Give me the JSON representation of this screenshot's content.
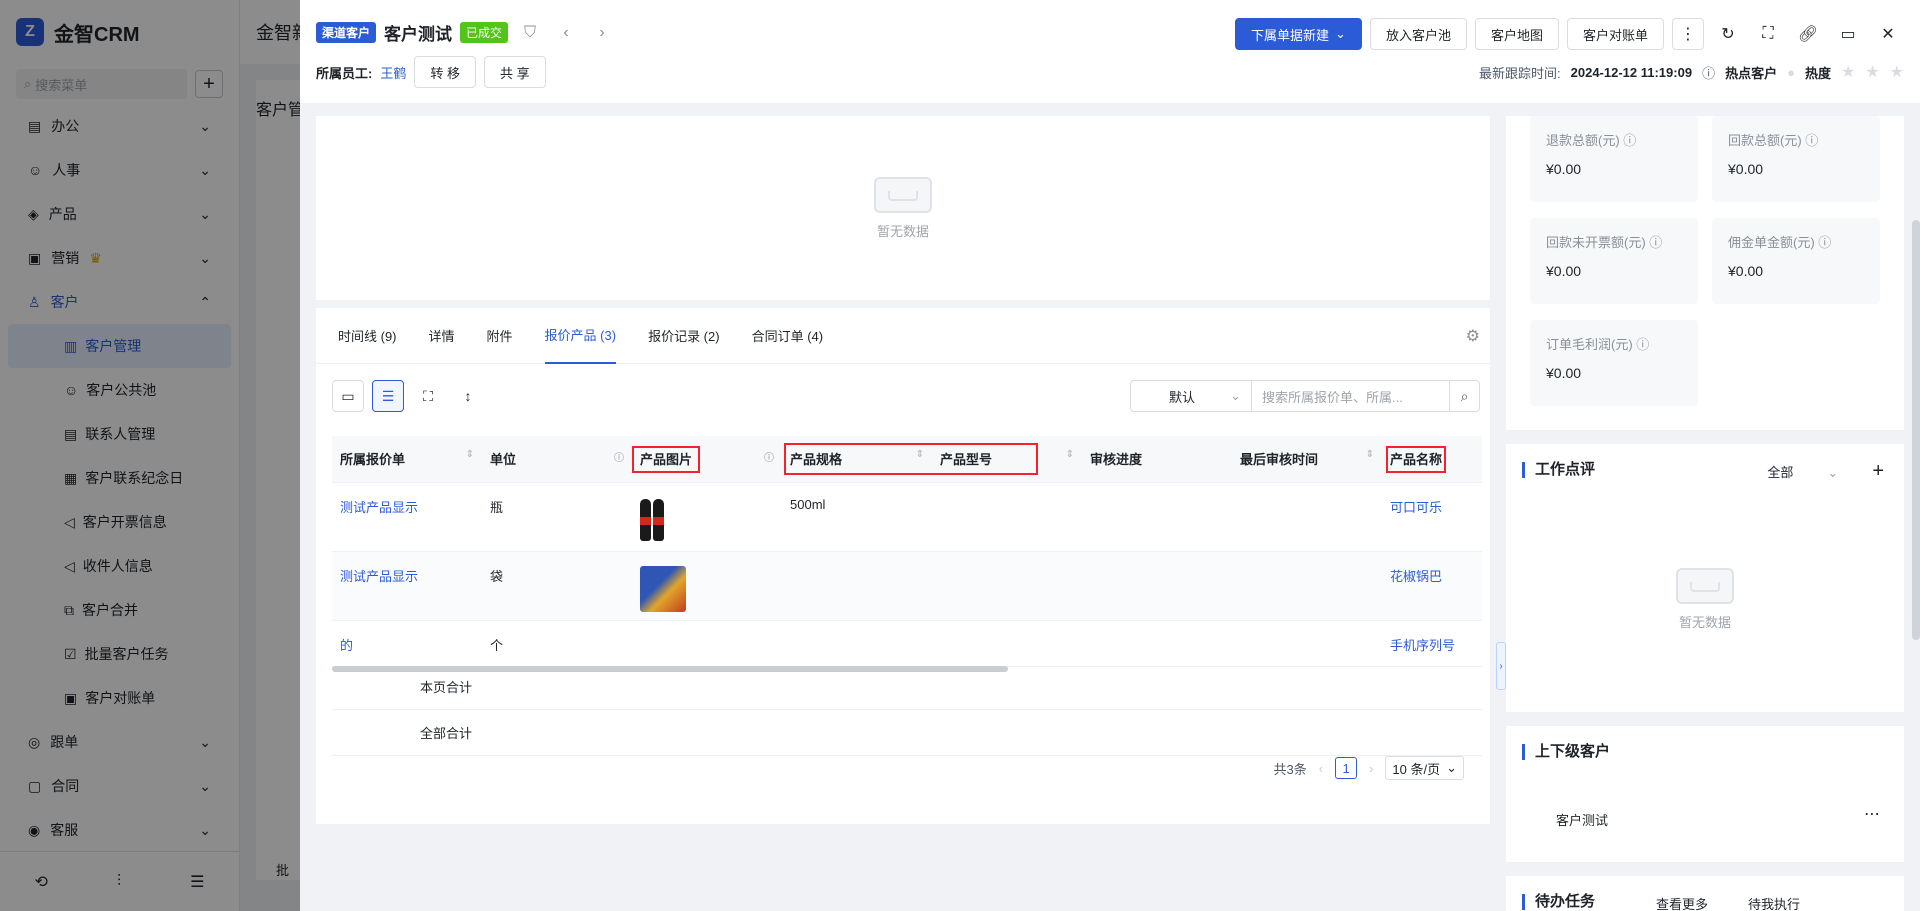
{
  "app": {
    "name": "金智CRM",
    "header_title": "金智新",
    "search_placeholder": "搜索菜单",
    "menu": [
      {
        "label": "办公",
        "icon": "calendar-icon"
      },
      {
        "label": "人事",
        "icon": "people-icon"
      },
      {
        "label": "产品",
        "icon": "box-icon"
      },
      {
        "label": "营销",
        "icon": "gift-icon"
      },
      {
        "label": "客户",
        "icon": "user-icon"
      }
    ],
    "customer_submenu": [
      "客户管理",
      "客户公共池",
      "联系人管理",
      "客户联系纪念日",
      "客户开票信息",
      "收件人信息",
      "客户合并",
      "批量客户任务",
      "客户对账单"
    ],
    "menu_bottom": [
      {
        "label": "跟单"
      },
      {
        "label": "合同"
      },
      {
        "label": "客服"
      }
    ],
    "bg_page_title": "客户管",
    "bg_bottom_button": "批"
  },
  "drawer": {
    "tag_channel": "渠道客户",
    "customer_name": "客户测试",
    "tag_status": "已成交",
    "owner_label": "所属员工:",
    "owner_name": "王鹤",
    "transfer_label": "转 移",
    "share_label": "共 享",
    "new_doc_label": "下属单据新建",
    "put_pool_label": "放入客户池",
    "map_label": "客户地图",
    "statement_label": "客户对账单",
    "last_follow_label": "最新跟踪时间:",
    "last_follow_time": "2024-12-12 11:19:09",
    "hot_label": "热点客户",
    "heat_label": "热度",
    "heat_stars": 0
  },
  "top_panel": {
    "empty_text": "暂无数据"
  },
  "tabs": [
    {
      "label": "时间线 (9)"
    },
    {
      "label": "详情"
    },
    {
      "label": "附件"
    },
    {
      "label": "报价产品 (3)"
    },
    {
      "label": "报价记录 (2)"
    },
    {
      "label": "合同订单 (4)"
    }
  ],
  "toolbar": {
    "select_value": "默认",
    "search_placeholder": "搜索所属报价单、所属..."
  },
  "table": {
    "columns": [
      "所属报价单",
      "单位",
      "产品图片",
      "产品规格",
      "产品型号",
      "审核进度",
      "最后审核时间",
      "产品名称"
    ],
    "rows": [
      {
        "quote": "测试产品显示",
        "unit": "瓶",
        "image": "cola-bottles-image",
        "spec": "500ml",
        "model": "",
        "progress": "",
        "time": "",
        "name": "可口可乐"
      },
      {
        "quote": "测试产品显示",
        "unit": "袋",
        "image": "snack-bag-image",
        "spec": "",
        "model": "",
        "progress": "",
        "time": "",
        "name": "花椒锅巴"
      },
      {
        "quote": "的",
        "unit": "个",
        "image": "",
        "spec": "",
        "model": "",
        "progress": "",
        "time": "",
        "name": "手机序列号"
      }
    ],
    "page_total_label": "本页合计",
    "all_total_label": "全部合计"
  },
  "pager": {
    "total_text": "共3条",
    "current_page": "1",
    "page_size": "10 条/页"
  },
  "stats": [
    {
      "label": "退款总额(元)",
      "value": "¥0.00"
    },
    {
      "label": "回款总额(元)",
      "value": "¥0.00"
    },
    {
      "label": "回款未开票额(元)",
      "value": "¥0.00"
    },
    {
      "label": "佣金单金额(元)",
      "value": "¥0.00"
    },
    {
      "label": "订单毛利润(元)",
      "value": "¥0.00"
    }
  ],
  "work_review": {
    "title": "工作点评",
    "filter": "全部",
    "empty_text": "暂无数据"
  },
  "parent_customer": {
    "title": "上下级客户",
    "item": "客户测试"
  },
  "todo": {
    "title": "待办任务",
    "more": "查看更多",
    "filter": "待我执行"
  }
}
